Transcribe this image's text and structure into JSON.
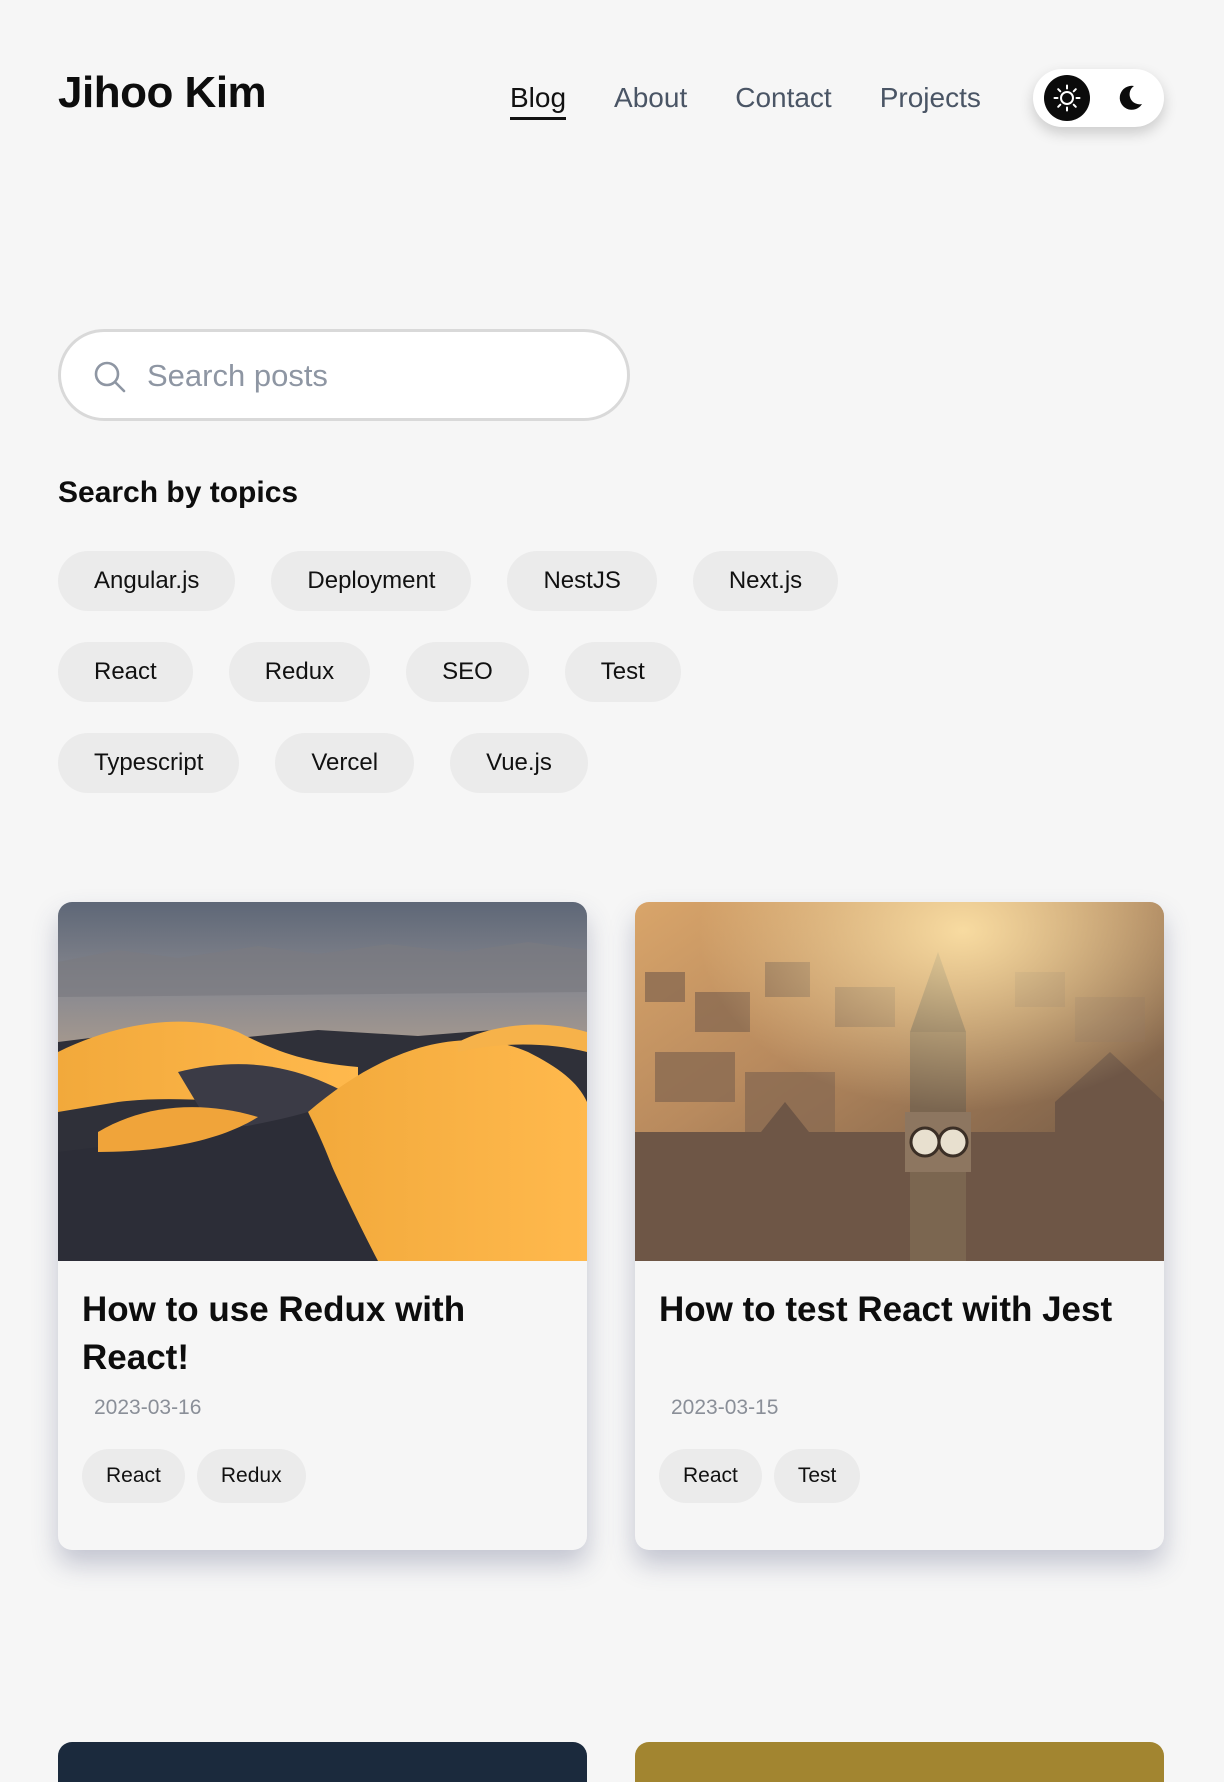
{
  "header": {
    "site_title": "Jihoo Kim",
    "nav": [
      {
        "label": "Blog",
        "active": true
      },
      {
        "label": "About",
        "active": false
      },
      {
        "label": "Contact",
        "active": false
      },
      {
        "label": "Projects",
        "active": false
      }
    ],
    "theme_toggle": {
      "light_icon": "sun-icon",
      "dark_icon": "moon-icon",
      "selected": "light"
    }
  },
  "search": {
    "placeholder": "Search posts",
    "value": "",
    "icon": "search-icon"
  },
  "topics": {
    "heading": "Search by topics",
    "rows": [
      [
        "Angular.js",
        "Deployment",
        "NestJS",
        "Next.js"
      ],
      [
        "React",
        "Redux",
        "SEO",
        "Test"
      ],
      [
        "Typescript",
        "Vercel",
        "Vue.js"
      ]
    ]
  },
  "posts": [
    {
      "title": "How to use Redux with React!",
      "date": "2023-03-16",
      "tags": [
        "React",
        "Redux"
      ],
      "image": "desert-dunes-photo"
    },
    {
      "title": "How to test React with Jest",
      "date": "2023-03-15",
      "tags": [
        "React",
        "Test"
      ],
      "image": "london-big-ben-photo"
    }
  ],
  "partial_cards": [
    {
      "image": "dark-navy-photo",
      "color": "#1b2a3d"
    },
    {
      "image": "golden-photo",
      "color": "#a28530"
    }
  ],
  "colors": {
    "background": "#f6f6f6",
    "text": "#0d0d0d",
    "muted": "#4a5565",
    "chip": "#ebebeb"
  }
}
